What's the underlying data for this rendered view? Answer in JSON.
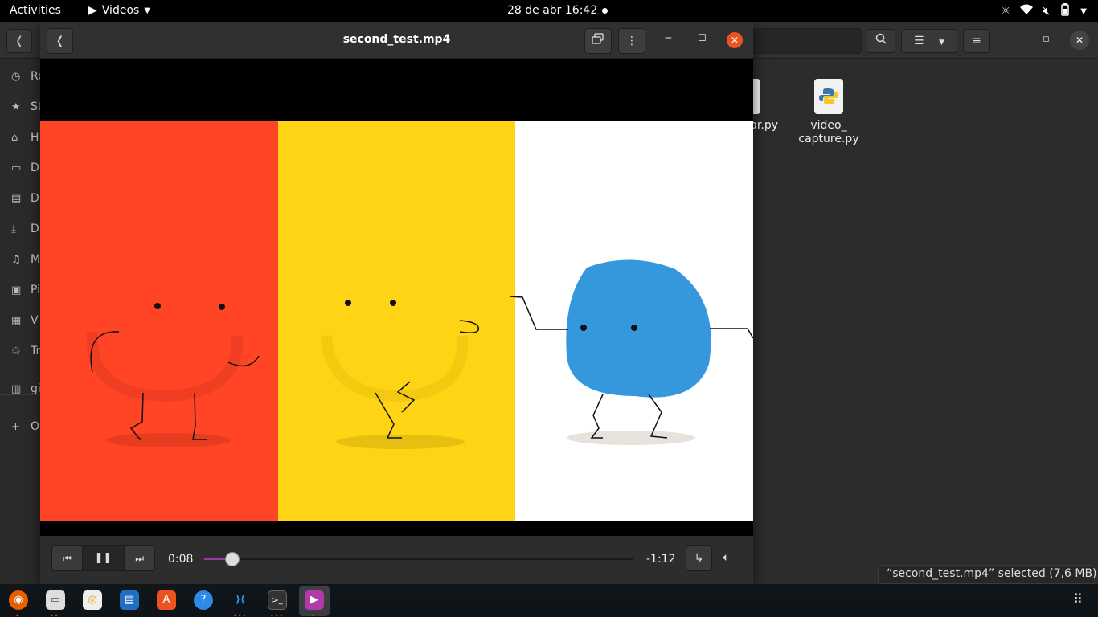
{
  "topbar": {
    "activities": "Activities",
    "app_name": "Videos",
    "clock": "28 de abr  16:42",
    "tray_icons": [
      "brightness-icon",
      "wifi-icon",
      "volume-muted-icon",
      "battery-icon",
      "power-menu-icon"
    ]
  },
  "file_manager": {
    "sidebar_items": [
      {
        "icon": "recent-icon",
        "label": "Re"
      },
      {
        "icon": "star-icon",
        "label": "St"
      },
      {
        "icon": "home-icon",
        "label": "H"
      },
      {
        "icon": "desktop-icon",
        "label": "D"
      },
      {
        "icon": "documents-icon",
        "label": "D"
      },
      {
        "icon": "downloads-icon",
        "label": "D"
      },
      {
        "icon": "music-icon",
        "label": "M"
      },
      {
        "icon": "pictures-icon",
        "label": "Pi"
      },
      {
        "icon": "videos-icon",
        "label": "V"
      },
      {
        "icon": "trash-icon",
        "label": "Tr"
      },
      {
        "icon": "drive-icon",
        "label": "gi"
      },
      {
        "icon": "plus-icon",
        "label": "O"
      }
    ],
    "files": [
      {
        "name_line1": "ar.py",
        "name_line2": ""
      },
      {
        "name_line1": "video_",
        "name_line2": "capture.py"
      }
    ],
    "status": "“second_test.mp4” selected  (7,6 MB)"
  },
  "video_window": {
    "title": "second_test.mp4",
    "current_time": "0:08",
    "remaining_time": "-1:12",
    "progress_fraction": 0.066,
    "colors": {
      "panel_red": "#ff4526",
      "panel_yellow": "#ffd414",
      "panel_white": "#ffffff",
      "blob_blue": "#3598dd",
      "progress": "#9b3b9e",
      "close": "#e95420"
    }
  },
  "dock": {
    "items": [
      "firefox-icon",
      "files-icon",
      "rhythmbox-icon",
      "writer-icon",
      "software-icon",
      "help-icon",
      "vscode-icon",
      "terminal-icon",
      "videos-icon"
    ]
  }
}
